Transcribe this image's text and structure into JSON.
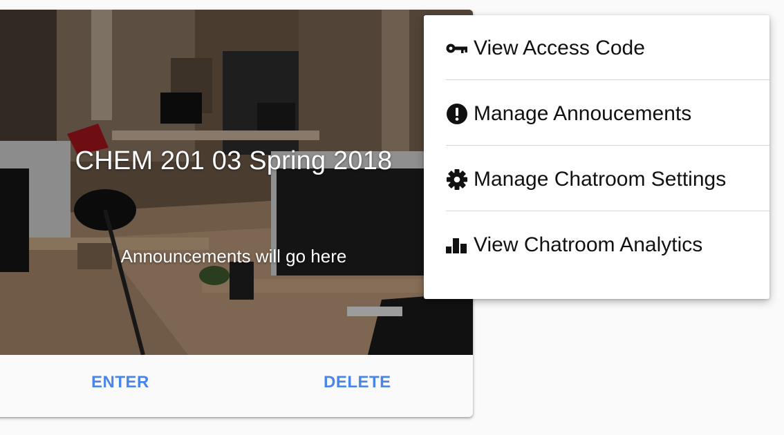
{
  "card": {
    "title": "CHEM 201 03 Spring 2018",
    "announcement": "Announcements will go here",
    "actions": {
      "enter_label": "ENTER",
      "delete_label": "DELETE"
    },
    "accent_color": "#4a86e8"
  },
  "menu": {
    "items": [
      {
        "label": "View Access Code",
        "icon": "key-icon"
      },
      {
        "label": "Manage Annoucements",
        "icon": "exclamation-circle-icon"
      },
      {
        "label": "Manage Chatroom Settings",
        "icon": "gear-icon"
      },
      {
        "label": "View Chatroom Analytics",
        "icon": "bar-chart-icon"
      }
    ]
  }
}
